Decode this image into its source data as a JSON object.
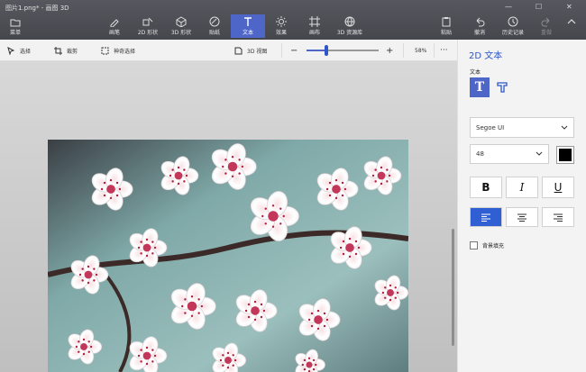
{
  "window": {
    "title": "图片1.png* - 画图 3D"
  },
  "menu": {
    "label": "菜单"
  },
  "toolbar": {
    "tools": [
      {
        "label": "画笔"
      },
      {
        "label": "2D 形状"
      },
      {
        "label": "3D 形状"
      },
      {
        "label": "贴纸"
      },
      {
        "label": "文本"
      },
      {
        "label": "效果"
      },
      {
        "label": "画布"
      },
      {
        "label": "3D 资源库"
      }
    ],
    "right": [
      {
        "label": "粘贴"
      },
      {
        "label": "撤消"
      },
      {
        "label": "历史记录"
      },
      {
        "label": "重做"
      }
    ]
  },
  "subbar": {
    "select": "选择",
    "crop": "裁剪",
    "magic_select": "神奇选择",
    "view3d": "3D 视图",
    "zoom_percent": "58%",
    "zoom_level": 0.28
  },
  "panel": {
    "title": "2D 文本",
    "text_label": "文本",
    "font_family": "Segoe UI",
    "font_size": "48",
    "bold": "B",
    "italic": "I",
    "underline": "U",
    "bg_fill": "背景填充",
    "text_color": "#000000"
  }
}
